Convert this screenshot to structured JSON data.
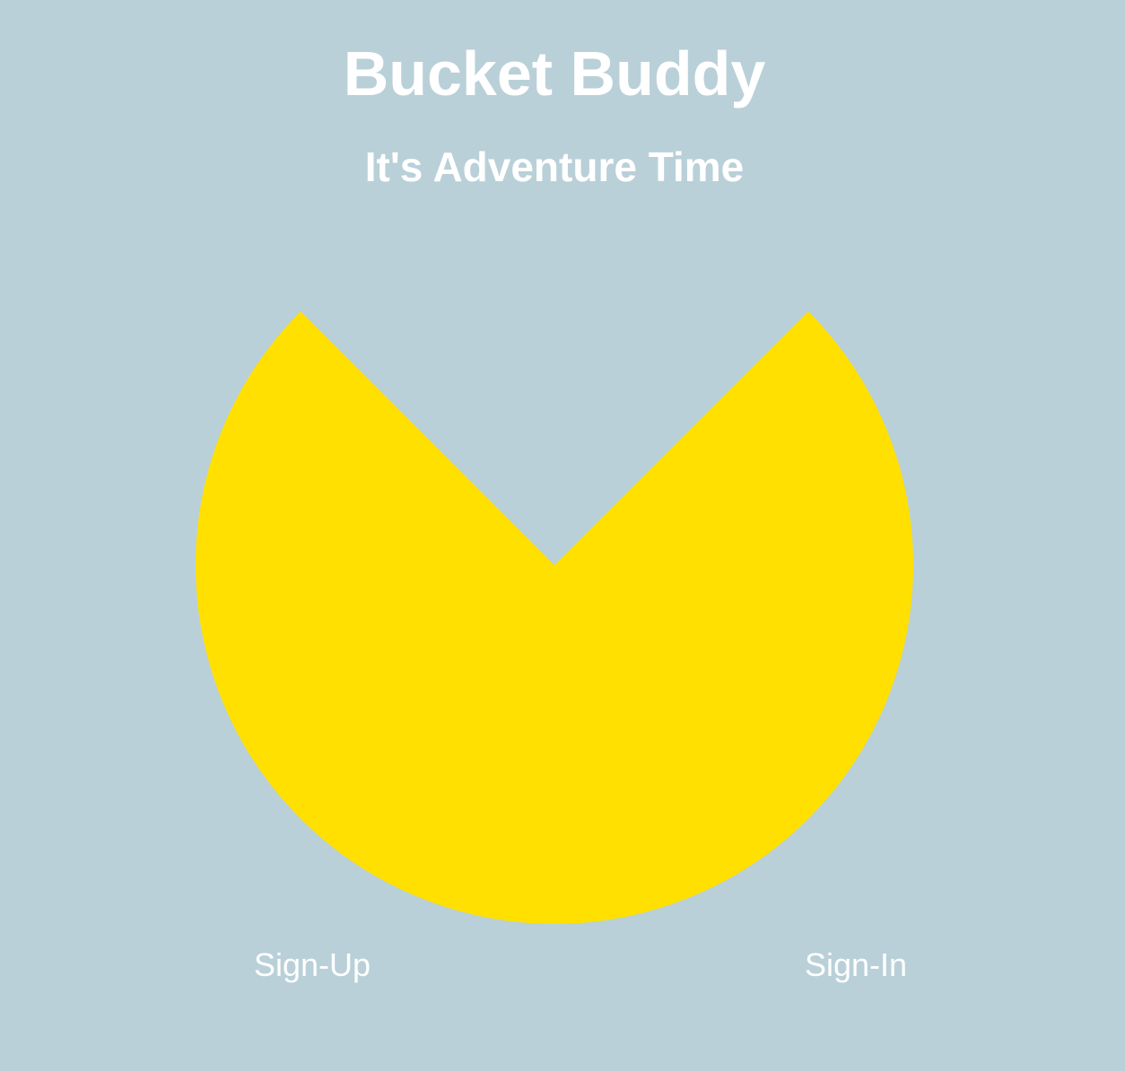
{
  "header": {
    "title": "Bucket Buddy",
    "subtitle": "It's Adventure Time"
  },
  "hero": {
    "shape_name": "pacman-logo",
    "fill_color": "#ffe000"
  },
  "nav": {
    "sign_up_label": "Sign-Up",
    "sign_in_label": "Sign-In"
  },
  "theme": {
    "background_color": "#b9d0d8",
    "text_color": "#ffffff"
  }
}
